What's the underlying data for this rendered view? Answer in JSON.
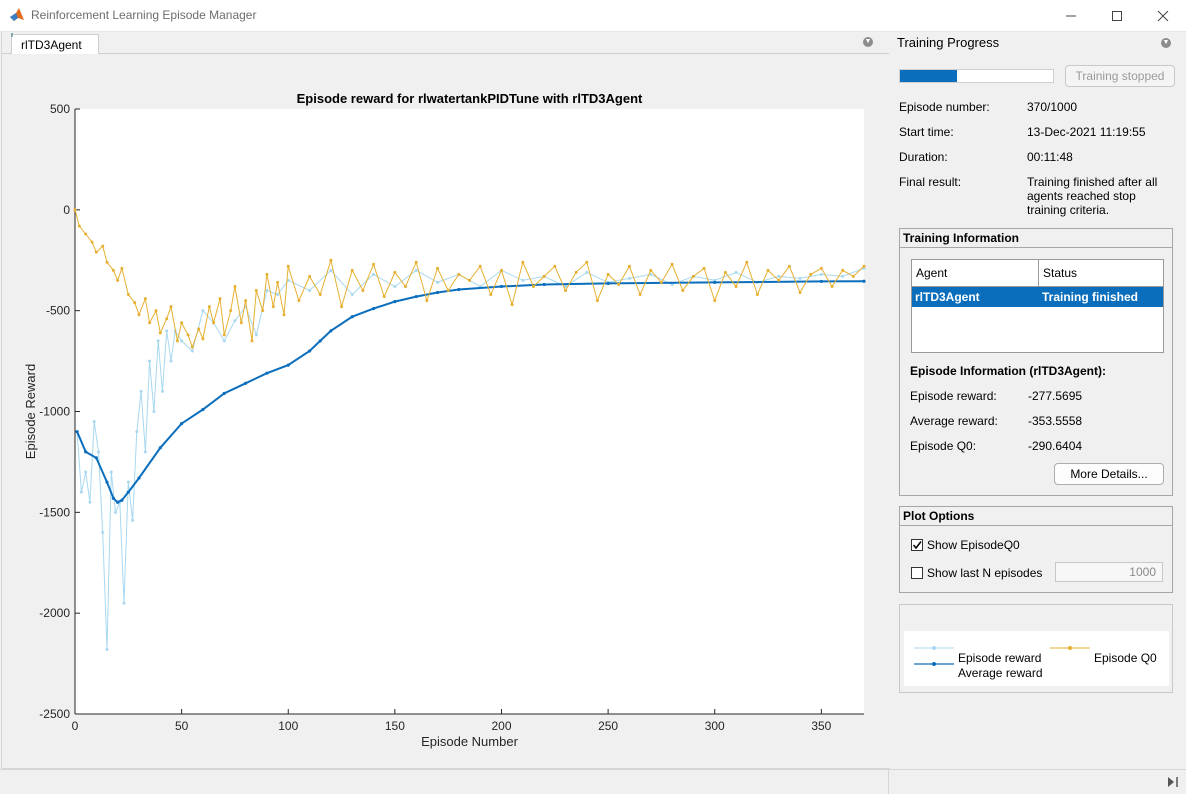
{
  "window": {
    "title": "Reinforcement Learning Episode Manager",
    "controls": [
      "minimize",
      "maximize",
      "close"
    ]
  },
  "tabs": [
    {
      "label": "rlTD3Agent",
      "active": true
    }
  ],
  "chart_data": {
    "type": "line",
    "title": "Episode reward for rlwatertankPIDTune with rlTD3Agent",
    "xlabel": "Episode Number",
    "ylabel": "Episode Reward",
    "xlim": [
      0,
      370
    ],
    "ylim": [
      -2500,
      500
    ],
    "xticks": [
      0,
      50,
      100,
      150,
      200,
      250,
      300,
      350
    ],
    "yticks": [
      500,
      0,
      -500,
      -1000,
      -1500,
      -2000,
      -2500
    ],
    "grid": false,
    "series": [
      {
        "name": "Episode reward",
        "color": "#a8d8f0",
        "x": [
          1,
          3,
          5,
          7,
          9,
          11,
          13,
          15,
          17,
          19,
          21,
          23,
          25,
          27,
          29,
          31,
          33,
          35,
          37,
          39,
          41,
          43,
          45,
          47,
          50,
          55,
          60,
          65,
          70,
          75,
          80,
          85,
          90,
          95,
          100,
          110,
          120,
          130,
          140,
          150,
          160,
          170,
          180,
          190,
          200,
          210,
          220,
          230,
          240,
          250,
          260,
          270,
          280,
          290,
          300,
          310,
          320,
          330,
          340,
          350,
          360,
          370
        ],
        "y": [
          -1100,
          -1400,
          -1300,
          -1450,
          -1050,
          -1200,
          -1600,
          -2180,
          -1300,
          -1500,
          -1450,
          -1950,
          -1350,
          -1540,
          -1100,
          -900,
          -1200,
          -750,
          -1000,
          -650,
          -900,
          -600,
          -750,
          -600,
          -650,
          -700,
          -500,
          -560,
          -650,
          -550,
          -480,
          -620,
          -400,
          -420,
          -350,
          -400,
          -300,
          -420,
          -320,
          -380,
          -300,
          -360,
          -320,
          -380,
          -300,
          -350,
          -330,
          -380,
          -310,
          -360,
          -340,
          -320,
          -370,
          -330,
          -350,
          -310,
          -360,
          -330,
          -340,
          -320,
          -330,
          -290
        ]
      },
      {
        "name": "Average reward",
        "color": "#0a6ebd",
        "x": [
          1,
          5,
          10,
          15,
          18,
          20,
          22,
          25,
          30,
          40,
          50,
          60,
          70,
          80,
          90,
          100,
          110,
          115,
          120,
          130,
          140,
          150,
          160,
          170,
          180,
          200,
          220,
          250,
          300,
          350,
          370
        ],
        "y": [
          -1100,
          -1200,
          -1230,
          -1350,
          -1430,
          -1450,
          -1440,
          -1400,
          -1330,
          -1180,
          -1060,
          -990,
          -910,
          -860,
          -810,
          -770,
          -700,
          -650,
          -600,
          -530,
          -490,
          -455,
          -430,
          -410,
          -395,
          -380,
          -370,
          -365,
          -360,
          -355,
          -354
        ]
      },
      {
        "name": "Episode Q0",
        "color": "#e6b030",
        "x": [
          0,
          2,
          5,
          8,
          10,
          13,
          15,
          18,
          20,
          22,
          25,
          28,
          30,
          33,
          35,
          38,
          40,
          43,
          45,
          48,
          50,
          53,
          55,
          58,
          60,
          63,
          65,
          68,
          70,
          73,
          75,
          78,
          80,
          83,
          85,
          88,
          90,
          93,
          95,
          98,
          100,
          105,
          110,
          115,
          120,
          125,
          130,
          135,
          140,
          145,
          150,
          155,
          160,
          165,
          170,
          175,
          180,
          185,
          190,
          195,
          200,
          205,
          210,
          215,
          220,
          225,
          230,
          235,
          240,
          245,
          250,
          255,
          260,
          265,
          270,
          275,
          280,
          285,
          290,
          295,
          300,
          305,
          310,
          315,
          320,
          325,
          330,
          335,
          340,
          345,
          350,
          355,
          360,
          365,
          370
        ],
        "y": [
          0,
          -80,
          -120,
          -160,
          -210,
          -180,
          -260,
          -300,
          -350,
          -290,
          -420,
          -460,
          -520,
          -440,
          -560,
          -500,
          -610,
          -540,
          -480,
          -650,
          -560,
          -620,
          -680,
          -590,
          -640,
          -480,
          -560,
          -440,
          -620,
          -500,
          -380,
          -560,
          -450,
          -650,
          -400,
          -500,
          -320,
          -480,
          -360,
          -520,
          -280,
          -450,
          -330,
          -420,
          -250,
          -480,
          -300,
          -400,
          -270,
          -430,
          -310,
          -380,
          -260,
          -450,
          -290,
          -400,
          -320,
          -350,
          -280,
          -420,
          -300,
          -470,
          -260,
          -380,
          -330,
          -280,
          -400,
          -310,
          -260,
          -450,
          -320,
          -370,
          -280,
          -420,
          -300,
          -360,
          -270,
          -400,
          -330,
          -290,
          -450,
          -310,
          -380,
          -260,
          -420,
          -300,
          -350,
          -280,
          -410,
          -320,
          -290,
          -380,
          -300,
          -330,
          -280
        ]
      }
    ]
  },
  "training_progress": {
    "header": "Training Progress",
    "progress_fraction": 0.37,
    "button_label": "Training stopped",
    "episode_number_label": "Episode number:",
    "episode_number_value": "370/1000",
    "start_time_label": "Start time:",
    "start_time_value": "13-Dec-2021 11:19:55",
    "duration_label": "Duration:",
    "duration_value": "00:11:48",
    "final_result_label": "Final result:",
    "final_result_line1": "Training finished after all",
    "final_result_line2": "agents reached stop",
    "final_result_line3": "training criteria."
  },
  "training_info": {
    "title": "Training Information",
    "col_agent": "Agent",
    "col_status": "Status",
    "row_agent": "rlTD3Agent",
    "row_status": "Training finished",
    "episode_info_title": "Episode Information (rlTD3Agent):",
    "episode_reward_label": "Episode reward:",
    "episode_reward_value": "-277.5695",
    "average_reward_label": "Average reward:",
    "average_reward_value": "-353.5558",
    "episode_q0_label": "Episode Q0:",
    "episode_q0_value": "-290.6404",
    "more_details": "More Details..."
  },
  "plot_options": {
    "title": "Plot Options",
    "show_q0_label": "Show EpisodeQ0",
    "show_q0_checked": true,
    "show_last_n_label": "Show last N episodes",
    "show_last_n_checked": false,
    "last_n_value": "1000"
  },
  "legend": {
    "episode_reward": "Episode reward",
    "episode_q0": "Episode Q0",
    "average_reward": "Average reward"
  }
}
